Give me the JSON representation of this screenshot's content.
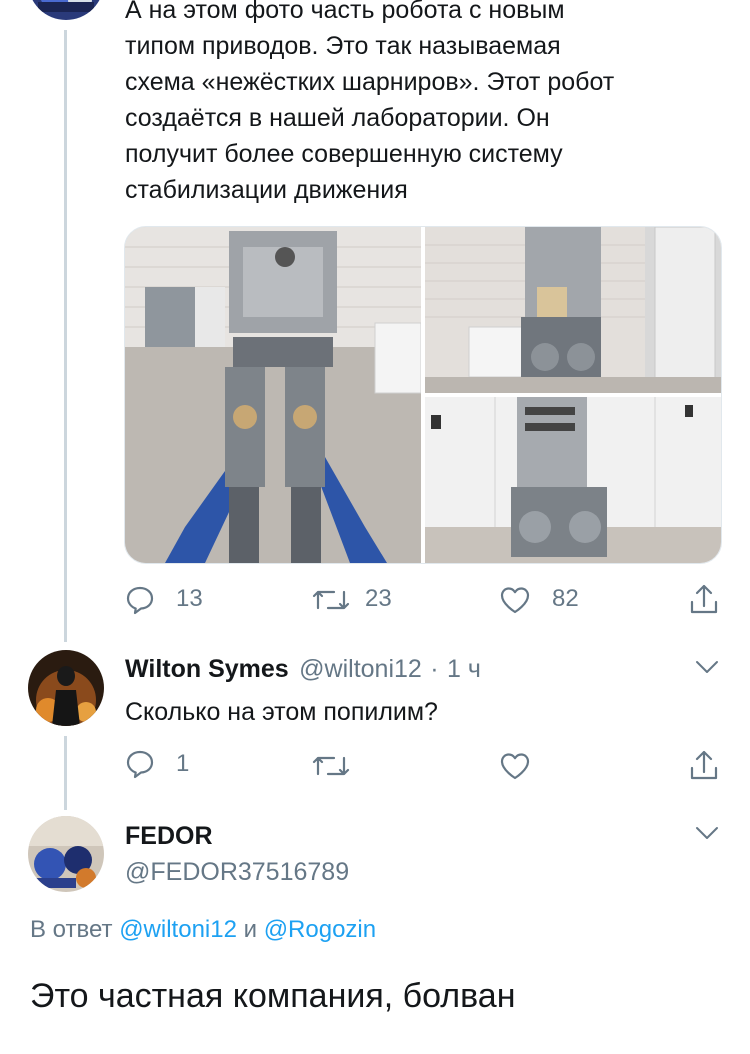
{
  "tweet_main": {
    "text": "А на этом фото часть робота с новым\nтипом приводов. Это так называемая\nсхема «нежёстких шарниров». Этот робот\nсоздаётся в нашей лаборатории. Он\nполучит более совершенную систему\nстабилизации движения",
    "actions": {
      "replies": "13",
      "retweets": "23",
      "likes": "82"
    }
  },
  "reply_1": {
    "name": "Wilton Symes",
    "handle": "@wiltoni12",
    "separator": "·",
    "time": "1 ч",
    "text": "Сколько на этом попилим?",
    "actions": {
      "replies": "1"
    }
  },
  "reply_2": {
    "name": "FEDOR",
    "handle": "@FEDOR37516789",
    "reply_prefix": "В ответ",
    "reply_user_1": "@wiltoni12",
    "reply_and": "и",
    "reply_user_2": "@Rogozin",
    "text": "Это частная компания, болван"
  },
  "colors": {
    "text": "#14171a",
    "secondary": "#657786",
    "link": "#1da1f2",
    "line": "#ccd6dd"
  }
}
